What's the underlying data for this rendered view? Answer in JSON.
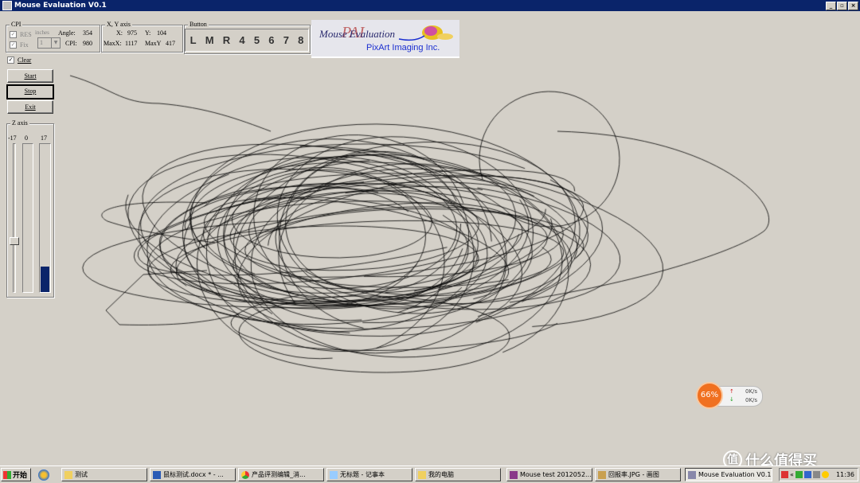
{
  "window": {
    "title": "Mouse Evaluation V0.1",
    "minimize": "_",
    "maximize": "▫",
    "close": "×"
  },
  "cpi": {
    "legend": "CPI",
    "res_label": "RES",
    "fix_label": "Fix",
    "inches_label": "inches",
    "inches_value": "1",
    "angle_label": "Angle:",
    "angle_value": "354",
    "cpi_label": "CPI:",
    "cpi_value": "980"
  },
  "xy": {
    "legend": "X, Y axis",
    "x_label": "X:",
    "x_value": "975",
    "y_label": "Y:",
    "y_value": "104",
    "maxx_label": "MaxX:",
    "maxx_value": "1117",
    "maxy_label": "MaxY",
    "maxy_value": "417"
  },
  "buttons_panel": {
    "legend": "Button",
    "keys": [
      "L",
      "M",
      "R",
      "4",
      "5",
      "6",
      "7",
      "8"
    ]
  },
  "logo": {
    "title": "Mouse Evaluation",
    "company": "PixArt Imaging Inc."
  },
  "controls": {
    "clear_label": "Clear",
    "start_label": "Start",
    "stop_label": "Stop",
    "exit_label": "Exit"
  },
  "zaxis": {
    "legend": "Z axis",
    "min": "-17",
    "zero": "0",
    "max": "17"
  },
  "widget": {
    "percent": "66%",
    "up": "0K/s",
    "down": "0K/s"
  },
  "taskbar": {
    "start": "开始",
    "tasks": [
      "测试",
      "鼠标测试.docx * - ...",
      "产品评测编辑_消...",
      "无标题 - 记事本",
      "我的电脑",
      "Mouse test 2012052...",
      "回报率.JPG - 画图",
      "Mouse Evaluation V0.1"
    ],
    "clock": "11:36"
  },
  "watermark": "什么值得买",
  "colors": {
    "titlebar": "#0a246a",
    "face": "#d4d0c8",
    "zbar_fill": "#0a246a",
    "widget_orange": "#f07020"
  }
}
